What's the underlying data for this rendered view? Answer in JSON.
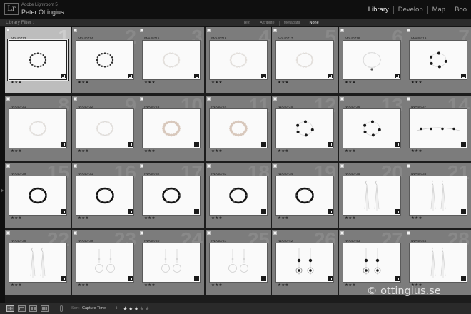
{
  "window": {
    "app_name": "Adobe Lightroom 5",
    "user_name": "Peter Ottingius",
    "logo": "Lr"
  },
  "modules": [
    {
      "label": "Library",
      "active": true
    },
    {
      "label": "Develop",
      "active": false
    },
    {
      "label": "Map",
      "active": false
    },
    {
      "label": "Boo",
      "active": false
    }
  ],
  "library_filter": {
    "label": "Library Filter :",
    "tabs": [
      {
        "label": "Text",
        "active": false
      },
      {
        "label": "Attribute",
        "active": false
      },
      {
        "label": "Metadata",
        "active": false
      },
      {
        "label": "None",
        "active": true
      }
    ]
  },
  "photos": [
    {
      "num": "1",
      "name": "IWA40713",
      "stars": "★★★",
      "kind": "bracelet-dark",
      "selected": true
    },
    {
      "num": "2",
      "name": "IWA40714",
      "stars": "★★★",
      "kind": "bracelet-dark"
    },
    {
      "num": "3",
      "name": "IWA40715",
      "stars": "★★★",
      "kind": "bracelet-light"
    },
    {
      "num": "4",
      "name": "IWA40716",
      "stars": "★★★",
      "kind": "bracelet-light"
    },
    {
      "num": "5",
      "name": "IWA40717",
      "stars": "★★★",
      "kind": "bracelet-light"
    },
    {
      "num": "6",
      "name": "IWA40718",
      "stars": "★★★",
      "kind": "bracelet-hang"
    },
    {
      "num": "7",
      "name": "IWA40719",
      "stars": "★★★",
      "kind": "bracelet-beads"
    },
    {
      "num": "8",
      "name": "IWA40721",
      "stars": "★★★",
      "kind": "bracelet-light"
    },
    {
      "num": "9",
      "name": "IWA40722",
      "stars": "★★★",
      "kind": "bracelet-light"
    },
    {
      "num": "10",
      "name": "IWA40723",
      "stars": "★★★",
      "kind": "bracelet-pearl"
    },
    {
      "num": "11",
      "name": "IWA40724",
      "stars": "★★★",
      "kind": "bracelet-pearl"
    },
    {
      "num": "12",
      "name": "IWA40725",
      "stars": "★★★",
      "kind": "bracelet-beads"
    },
    {
      "num": "13",
      "name": "IWA40726",
      "stars": "★★★",
      "kind": "bracelet-beads"
    },
    {
      "num": "14",
      "name": "IWA40727",
      "stars": "★★★",
      "kind": "chain-open"
    },
    {
      "num": "15",
      "name": "IWA40729",
      "stars": "★★★",
      "kind": "bracelet-black"
    },
    {
      "num": "16",
      "name": "IWA40731",
      "stars": "★★★",
      "kind": "bracelet-black"
    },
    {
      "num": "17",
      "name": "IWA40732",
      "stars": "★★★",
      "kind": "bracelet-black"
    },
    {
      "num": "18",
      "name": "IWA40733",
      "stars": "★★★",
      "kind": "bracelet-black"
    },
    {
      "num": "19",
      "name": "IWA40734",
      "stars": "★★★",
      "kind": "bracelet-black"
    },
    {
      "num": "20",
      "name": "IWA40735",
      "stars": "★★★",
      "kind": "earrings-long"
    },
    {
      "num": "21",
      "name": "IWA40736",
      "stars": "★★★",
      "kind": "earrings-long"
    },
    {
      "num": "22",
      "name": "IWA40738",
      "stars": "★★★",
      "kind": "earrings-long"
    },
    {
      "num": "23",
      "name": "IWA40739",
      "stars": "★★★",
      "kind": "earrings-hoop"
    },
    {
      "num": "24",
      "name": "IWA40740",
      "stars": "★★★",
      "kind": "earrings-hoop"
    },
    {
      "num": "25",
      "name": "IWA40741",
      "stars": "★★★",
      "kind": "earrings-hoop"
    },
    {
      "num": "26",
      "name": "IWA40742",
      "stars": "★★★",
      "kind": "earrings-beads"
    },
    {
      "num": "27",
      "name": "IWA40743",
      "stars": "★★★",
      "kind": "earrings-beads"
    },
    {
      "num": "28",
      "name": "IWA40744",
      "stars": "★★★",
      "kind": "earrings-long"
    }
  ],
  "toolbar": {
    "sort_label": "Sort:",
    "sort_value": "Capture Time",
    "sort_arrows": "⇕",
    "rating_filled": "★★★",
    "rating_empty": "★★",
    "view_icons": [
      "grid-view-icon",
      "loupe-view-icon",
      "compare-view-icon",
      "survey-view-icon"
    ]
  },
  "watermark": "© ottingius.se",
  "colors": {
    "accent_text": "#ececec",
    "grid_cell": "#7c7c7c",
    "grid_cell_selected": "#bdbdbd",
    "background": "#1a1a1a"
  }
}
